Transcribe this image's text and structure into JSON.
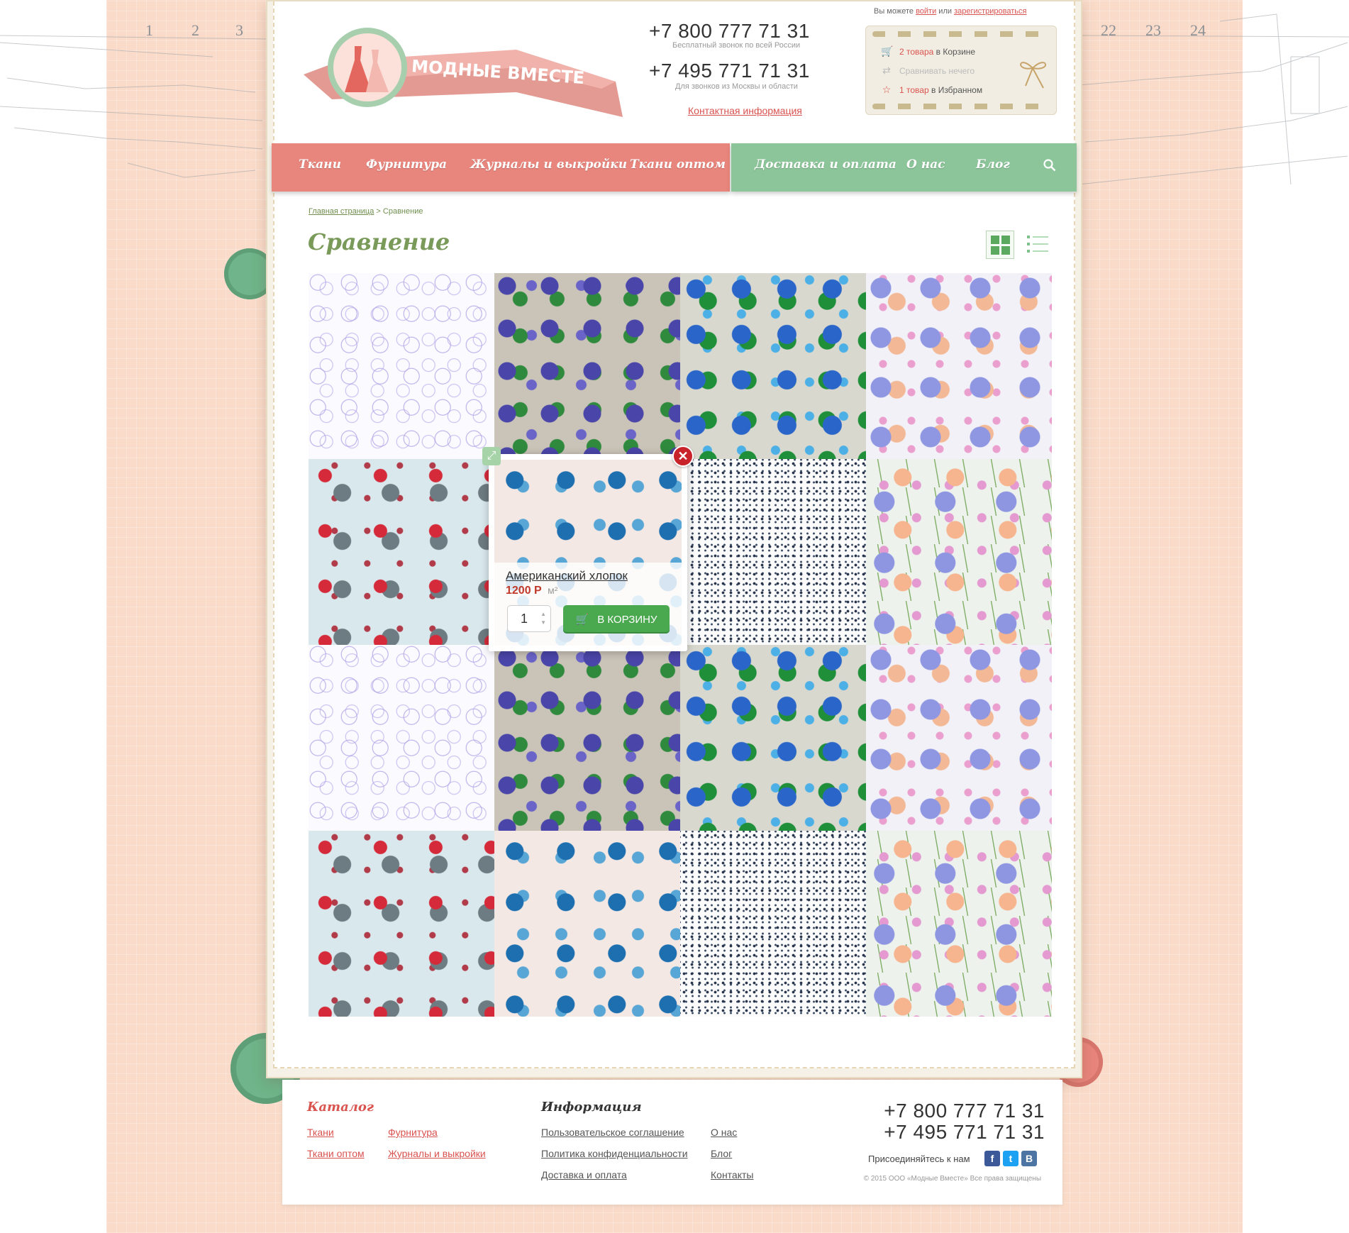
{
  "header": {
    "auth": {
      "prefix": "Вы можете",
      "login": "войти",
      "or": "или",
      "register": "зарегистрироваться"
    },
    "phone1": "+7 800 777 71 31",
    "phone1_sub": "Бесплатный звонок по всей России",
    "phone2": "+7 495 771 71 31",
    "phone2_sub": "Для звонков из Москвы и области",
    "contact_link": "Контактная информация",
    "logo_text": "МОДНЫЕ ВМЕСТЕ",
    "cart": {
      "cart_count": "2 товара",
      "cart_label": "в Корзине",
      "compare_label": "Сравнивать нечего",
      "fav_count": "1 товар",
      "fav_label": "в Избранном"
    }
  },
  "nav": {
    "left": [
      "Ткани",
      "Фурнитура",
      "Журналы и выкройки",
      "Ткани оптом"
    ],
    "right": [
      "Доставка и оплата",
      "О нас",
      "Блог"
    ]
  },
  "breadcrumb": {
    "home": "Главная страница",
    "sep": ">",
    "current": "Сравнение"
  },
  "page_title": "Сравнение",
  "popup": {
    "name": "Американский хлопок",
    "price": "1200",
    "currency": "Р",
    "unit": "м²",
    "qty": "1",
    "buy_label": "В КОРЗИНУ"
  },
  "footer": {
    "catalog_heading": "Каталог",
    "catalog_links": [
      "Ткани",
      "Фурнитура",
      "Ткани оптом",
      "Журналы и выкройки"
    ],
    "info_heading": "Информация",
    "info_links": [
      "Пользовательское соглашение",
      "О нас",
      "Политика конфиденциальности",
      "Блог",
      "Доставка и оплата",
      "Контакты"
    ],
    "phone1": "+7 800 777 71 31",
    "phone2": "+7 495 771 71 31",
    "join": "Присоединяйтесь к нам",
    "social": [
      "f",
      "t",
      "B"
    ],
    "copyright": "© 2015 ООО «Модные Вместе» Все права защищены"
  },
  "ruler": [
    "1",
    "2",
    "3",
    "22",
    "23",
    "24"
  ],
  "colors": {
    "accent_red": "#d9534f",
    "nav_pink": "#e8857c",
    "nav_green": "#8cc59a",
    "buy_green": "#4aa84f",
    "title_green": "#7a9a5a"
  }
}
